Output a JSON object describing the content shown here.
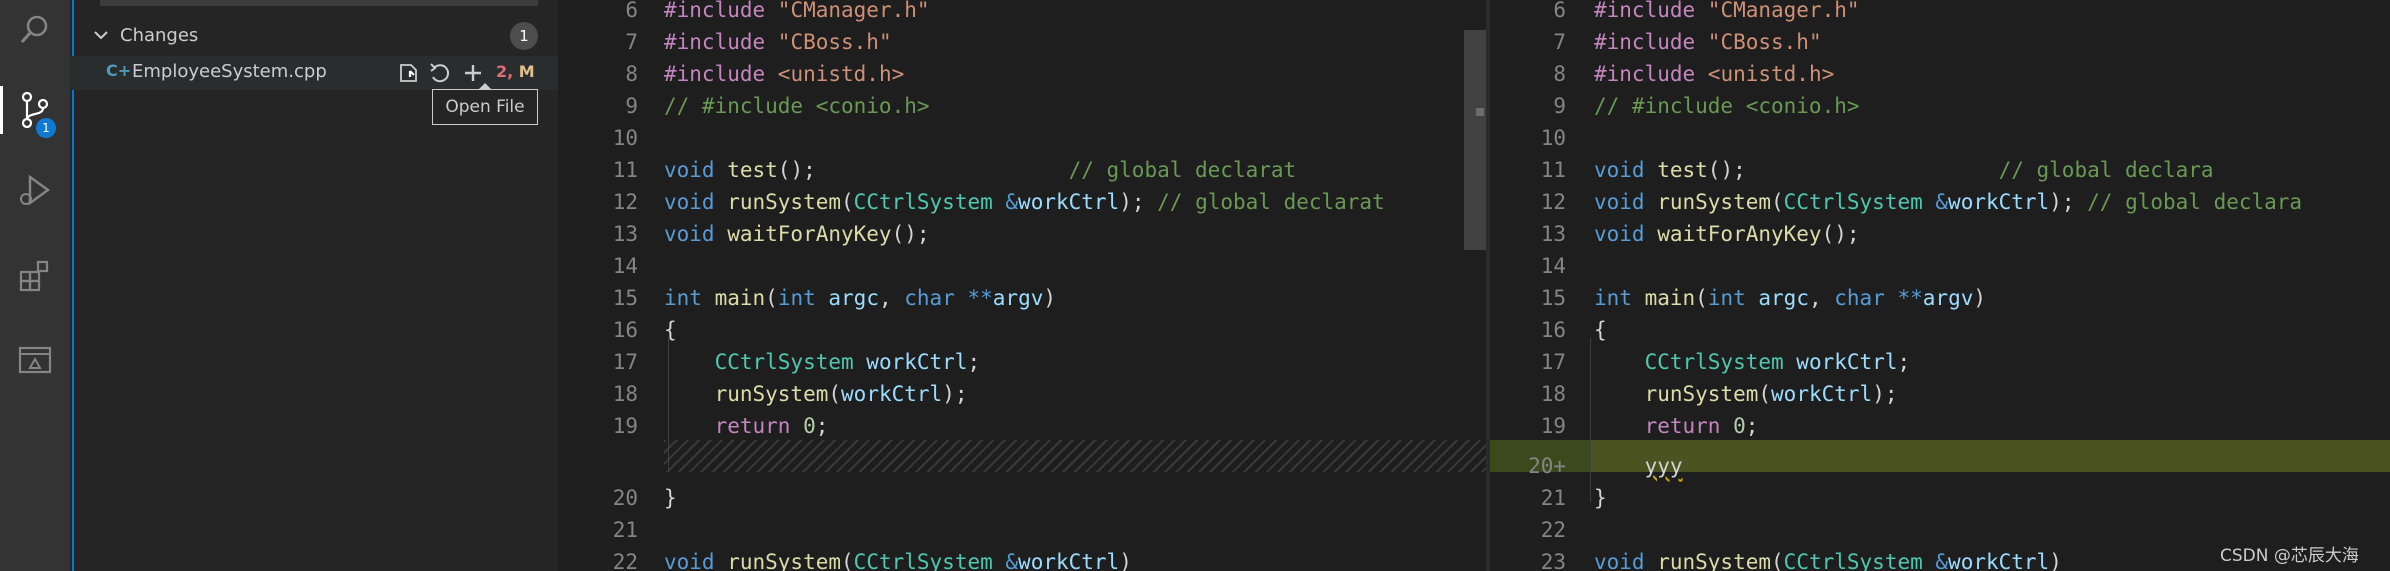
{
  "activity_bar": {
    "icons": [
      "search-icon",
      "source-control-icon",
      "run-debug-icon",
      "extensions-icon",
      "remote-explorer-icon"
    ],
    "scm_badge": "1"
  },
  "sidebar": {
    "changes_title": "Changes",
    "changes_count": "1",
    "file": {
      "icon_glyph": "C+",
      "name": "EmployeeSystem.cpp",
      "status_count": "2,",
      "status_letter": "M"
    },
    "tooltip": "Open File"
  },
  "left_editor": {
    "lines": [
      {
        "n": "6",
        "code": [
          [
            "pp",
            "#include "
          ],
          [
            "str",
            "\"CManager.h\""
          ]
        ]
      },
      {
        "n": "7",
        "code": [
          [
            "pp",
            "#include "
          ],
          [
            "str",
            "\"CBoss.h\""
          ]
        ]
      },
      {
        "n": "8",
        "code": [
          [
            "pp",
            "#include "
          ],
          [
            "str",
            "<unistd.h>"
          ]
        ]
      },
      {
        "n": "9",
        "code": [
          [
            "cm",
            "// #include <conio.h>"
          ]
        ]
      },
      {
        "n": "10",
        "code": []
      },
      {
        "n": "11",
        "code": [
          [
            "kw",
            "void "
          ],
          [
            "fn",
            "test"
          ],
          [
            "tx",
            "();                    "
          ],
          [
            "cm",
            "// global declarat"
          ]
        ]
      },
      {
        "n": "12",
        "code": [
          [
            "kw",
            "void "
          ],
          [
            "fn",
            "runSystem"
          ],
          [
            "tx",
            "("
          ],
          [
            "ty",
            "CCtrlSystem "
          ],
          [
            "kw",
            "&"
          ],
          [
            "id",
            "workCtrl"
          ],
          [
            "tx",
            "); "
          ],
          [
            "cm",
            "// global declarat"
          ]
        ]
      },
      {
        "n": "13",
        "code": [
          [
            "kw",
            "void "
          ],
          [
            "fn",
            "waitForAnyKey"
          ],
          [
            "tx",
            "();"
          ]
        ]
      },
      {
        "n": "14",
        "code": []
      },
      {
        "n": "15",
        "code": [
          [
            "kw",
            "int "
          ],
          [
            "fn",
            "main"
          ],
          [
            "tx",
            "("
          ],
          [
            "kw",
            "int "
          ],
          [
            "id",
            "argc"
          ],
          [
            "tx",
            ", "
          ],
          [
            "kw",
            "char "
          ],
          [
            "kw",
            "**"
          ],
          [
            "id",
            "argv"
          ],
          [
            "tx",
            ")"
          ]
        ]
      },
      {
        "n": "16",
        "code": [
          [
            "tx",
            "{"
          ]
        ]
      },
      {
        "n": "17",
        "code": [
          [
            "tx",
            "    "
          ],
          [
            "ty",
            "CCtrlSystem "
          ],
          [
            "id",
            "workCtrl"
          ],
          [
            "tx",
            ";"
          ]
        ]
      },
      {
        "n": "18",
        "code": [
          [
            "tx",
            "    "
          ],
          [
            "fn",
            "runSystem"
          ],
          [
            "tx",
            "("
          ],
          [
            "id",
            "workCtrl"
          ],
          [
            "tx",
            ");"
          ]
        ]
      },
      {
        "n": "19",
        "code": [
          [
            "tx",
            "    "
          ],
          [
            "pp",
            "return "
          ],
          [
            "num",
            "0"
          ],
          [
            "tx",
            ";"
          ]
        ]
      },
      {
        "n": "",
        "code": []
      },
      {
        "n": "20",
        "code": [
          [
            "tx",
            "}"
          ]
        ]
      },
      {
        "n": "21",
        "code": []
      },
      {
        "n": "22",
        "code": [
          [
            "kw",
            "void "
          ],
          [
            "fn",
            "runSystem"
          ],
          [
            "tx",
            "("
          ],
          [
            "ty",
            "CCtrlSystem "
          ],
          [
            "kw",
            "&"
          ],
          [
            "id",
            "workCtrl"
          ],
          [
            "tx",
            ")"
          ]
        ]
      }
    ]
  },
  "right_editor": {
    "lines": [
      {
        "n": "6",
        "code": [
          [
            "pp",
            "#include "
          ],
          [
            "str",
            "\"CManager.h\""
          ]
        ]
      },
      {
        "n": "7",
        "code": [
          [
            "pp",
            "#include "
          ],
          [
            "str",
            "\"CBoss.h\""
          ]
        ]
      },
      {
        "n": "8",
        "code": [
          [
            "pp",
            "#include "
          ],
          [
            "str",
            "<unistd.h>"
          ]
        ]
      },
      {
        "n": "9",
        "code": [
          [
            "cm",
            "// #include <conio.h>"
          ]
        ]
      },
      {
        "n": "10",
        "code": []
      },
      {
        "n": "11",
        "code": [
          [
            "kw",
            "void "
          ],
          [
            "fn",
            "test"
          ],
          [
            "tx",
            "();                    "
          ],
          [
            "cm",
            "// global declara"
          ]
        ]
      },
      {
        "n": "12",
        "code": [
          [
            "kw",
            "void "
          ],
          [
            "fn",
            "runSystem"
          ],
          [
            "tx",
            "("
          ],
          [
            "ty",
            "CCtrlSystem "
          ],
          [
            "kw",
            "&"
          ],
          [
            "id",
            "workCtrl"
          ],
          [
            "tx",
            "); "
          ],
          [
            "cm",
            "// global declara"
          ]
        ]
      },
      {
        "n": "13",
        "code": [
          [
            "kw",
            "void "
          ],
          [
            "fn",
            "waitForAnyKey"
          ],
          [
            "tx",
            "();"
          ]
        ]
      },
      {
        "n": "14",
        "code": []
      },
      {
        "n": "15",
        "code": [
          [
            "kw",
            "int "
          ],
          [
            "fn",
            "main"
          ],
          [
            "tx",
            "("
          ],
          [
            "kw",
            "int "
          ],
          [
            "id",
            "argc"
          ],
          [
            "tx",
            ", "
          ],
          [
            "kw",
            "char "
          ],
          [
            "kw",
            "**"
          ],
          [
            "id",
            "argv"
          ],
          [
            "tx",
            ")"
          ]
        ]
      },
      {
        "n": "16",
        "code": [
          [
            "tx",
            "{"
          ]
        ]
      },
      {
        "n": "17",
        "code": [
          [
            "tx",
            "    "
          ],
          [
            "ty",
            "CCtrlSystem "
          ],
          [
            "id",
            "workCtrl"
          ],
          [
            "tx",
            ";"
          ]
        ]
      },
      {
        "n": "18",
        "code": [
          [
            "tx",
            "    "
          ],
          [
            "fn",
            "runSystem"
          ],
          [
            "tx",
            "("
          ],
          [
            "id",
            "workCtrl"
          ],
          [
            "tx",
            ");"
          ]
        ]
      },
      {
        "n": "19",
        "code": [
          [
            "tx",
            "    "
          ],
          [
            "pp",
            "return "
          ],
          [
            "num",
            "0"
          ],
          [
            "tx",
            ";"
          ]
        ]
      },
      {
        "n": "20+",
        "code": [
          [
            "tx",
            "    "
          ],
          [
            "tx",
            "yyy"
          ]
        ]
      },
      {
        "n": "21",
        "code": [
          [
            "tx",
            "}"
          ]
        ]
      },
      {
        "n": "22",
        "code": []
      },
      {
        "n": "23",
        "code": [
          [
            "kw",
            "void "
          ],
          [
            "fn",
            "runSystem"
          ],
          [
            "tx",
            "("
          ],
          [
            "ty",
            "CCtrlSystem "
          ],
          [
            "kw",
            "&"
          ],
          [
            "id",
            "workCtrl"
          ],
          [
            "tx",
            ")"
          ]
        ]
      }
    ]
  },
  "watermark": "CSDN @芯辰大海"
}
